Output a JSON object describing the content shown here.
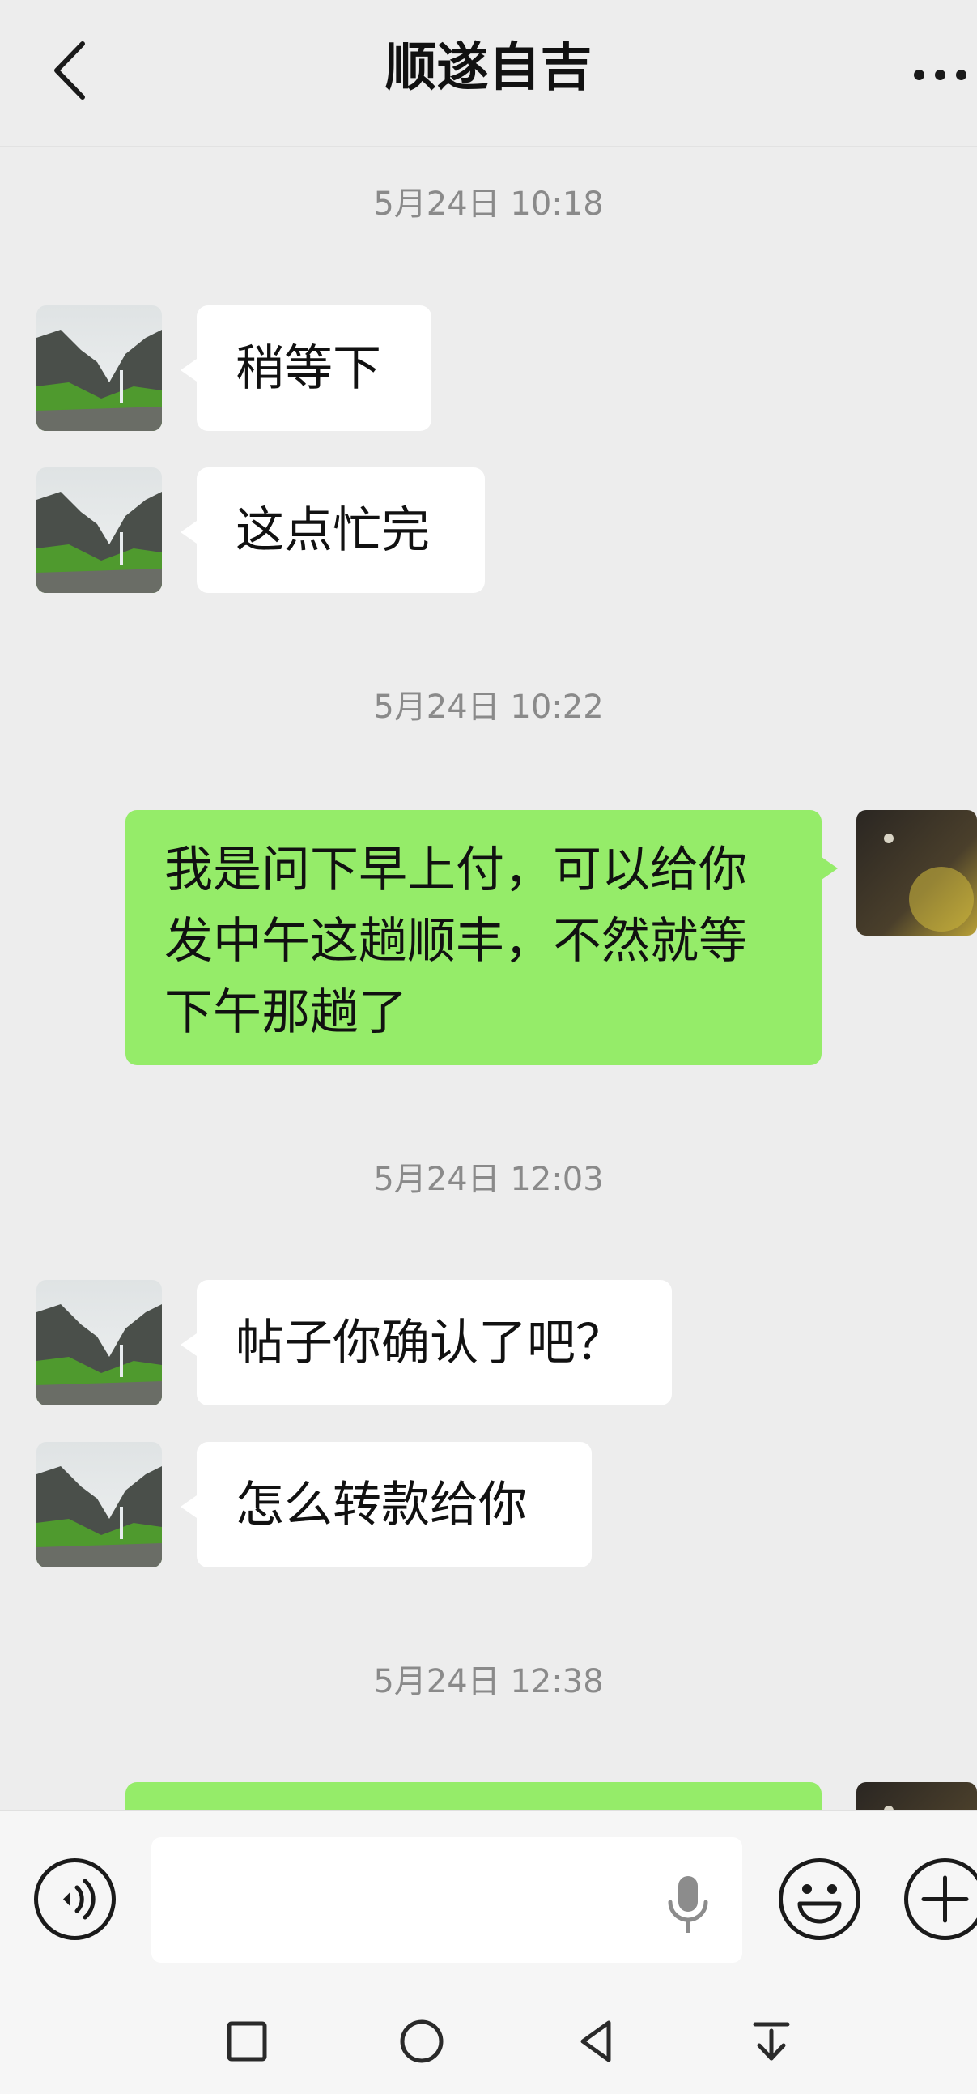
{
  "header": {
    "title": "顺遂自吉",
    "back_icon": "chevron-left-icon",
    "more_icon": "more-horizontal-icon"
  },
  "messages": [
    {
      "type": "timestamp",
      "text": "5月24日 10:18"
    },
    {
      "type": "received",
      "text": "稍等下"
    },
    {
      "type": "received",
      "text": "这点忙完"
    },
    {
      "type": "timestamp",
      "text": "5月24日 10:22"
    },
    {
      "type": "sent",
      "text": "我是问下早上付，可以给你发中午这趟顺丰，不然就等下午那趟了"
    },
    {
      "type": "timestamp",
      "text": "5月24日 12:03"
    },
    {
      "type": "received",
      "text": "帖子你确认了吧？"
    },
    {
      "type": "received",
      "text": "怎么转款给你"
    },
    {
      "type": "timestamp",
      "text": "5月24日 12:38"
    },
    {
      "type": "sent",
      "text": ""
    }
  ],
  "input_bar": {
    "value": "",
    "voice_icon": "voice-mode-icon",
    "mic_icon": "microphone-icon",
    "emoji_icon": "emoji-icon",
    "plus_icon": "plus-icon"
  },
  "nav_bar": {
    "icons": [
      "square-recents-icon",
      "circle-home-icon",
      "triangle-back-icon",
      "collapse-down-icon"
    ]
  },
  "colors": {
    "background": "#ededed",
    "sent_bubble": "#95ec69",
    "received_bubble": "#ffffff",
    "timestamp_text": "#8a8a8a"
  }
}
